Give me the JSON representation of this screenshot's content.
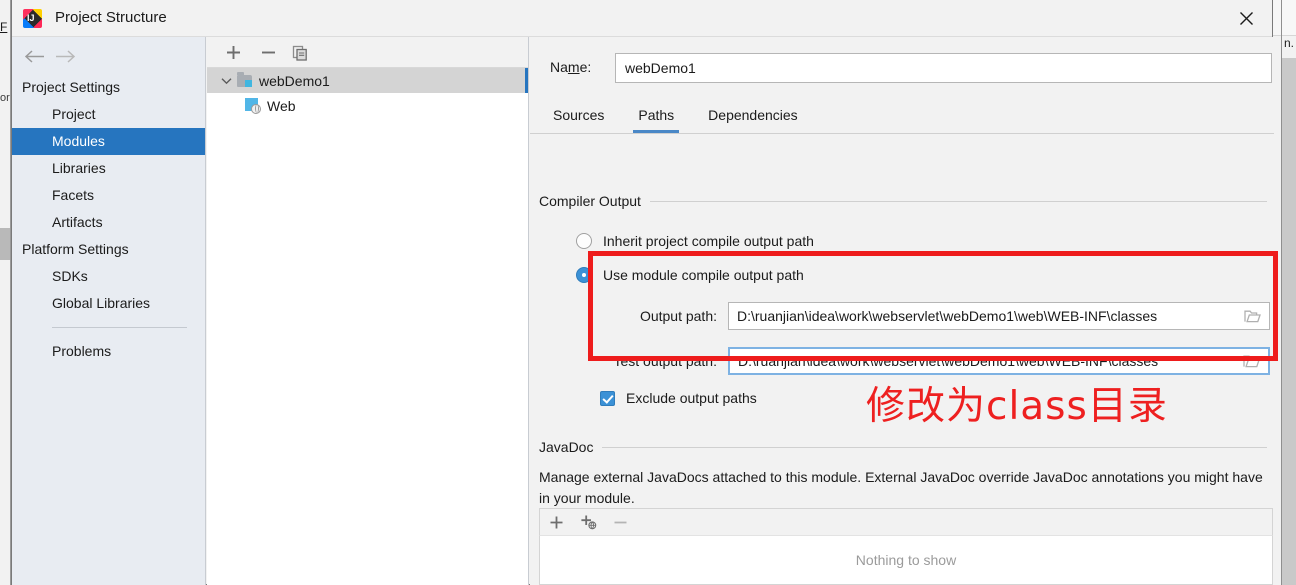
{
  "background": {
    "left_label": "F",
    "left_sub": "or",
    "right_text": "n."
  },
  "titlebar": {
    "app_icon": "intellij-idea-icon",
    "title": "Project Structure",
    "close_icon": "close-icon"
  },
  "nav": {
    "back_icon": "arrow-left-icon",
    "forward_icon": "arrow-right-icon",
    "groups": [
      {
        "label": "Project Settings",
        "items": [
          {
            "label": "Project",
            "selected": false
          },
          {
            "label": "Modules",
            "selected": true
          },
          {
            "label": "Libraries",
            "selected": false
          },
          {
            "label": "Facets",
            "selected": false
          },
          {
            "label": "Artifacts",
            "selected": false
          }
        ]
      },
      {
        "label": "Platform Settings",
        "items": [
          {
            "label": "SDKs",
            "selected": false
          },
          {
            "label": "Global Libraries",
            "selected": false
          }
        ]
      }
    ],
    "problems": "Problems"
  },
  "tree": {
    "toolbar": {
      "add_icon": "plus-icon",
      "remove_icon": "minus-icon",
      "copy_icon": "copy-icon"
    },
    "nodes": [
      {
        "label": "webDemo1",
        "icon": "module-folder-icon",
        "selected": true,
        "expanded": true
      },
      {
        "label": "Web",
        "icon": "web-facet-icon",
        "selected": false
      }
    ]
  },
  "content": {
    "name_label_pre": "Na",
    "name_label_mnemonic": "m",
    "name_label_post": "e:",
    "name_value": "webDemo1",
    "name_placeholder": "",
    "tabs": [
      {
        "label": "Sources",
        "active": false
      },
      {
        "label": "Paths",
        "active": true
      },
      {
        "label": "Dependencies",
        "active": false
      }
    ],
    "compiler_output": {
      "section_title": "Compiler Output",
      "radio_inherit": "Inherit project compile output path",
      "radio_module": "Use module compile output path",
      "output_path_label": "Output path:",
      "output_path_value": "D:\\ruanjian\\idea\\work\\webservlet\\webDemo1\\web\\WEB-INF\\classes",
      "test_output_path_label": "Test output path:",
      "test_output_path_value": "D:\\ruanjian\\idea\\work\\webservlet\\webDemo1\\web\\WEB-INF\\classes",
      "browse_icon": "folder-browse-icon",
      "exclude_checkbox": "Exclude output paths"
    },
    "javadoc": {
      "section_title": "JavaDoc",
      "description": "Manage external JavaDocs attached to this module. External JavaDoc override JavaDoc annotations you might have in your module.",
      "toolbar": {
        "add_icon": "plus-icon",
        "add_url_icon": "plus-globe-icon",
        "remove_icon": "minus-icon"
      },
      "empty_text": "Nothing to show"
    }
  },
  "annotation": {
    "text": "修改为class目录",
    "color": "#ee2020",
    "box_color": "#ee1c1c"
  }
}
